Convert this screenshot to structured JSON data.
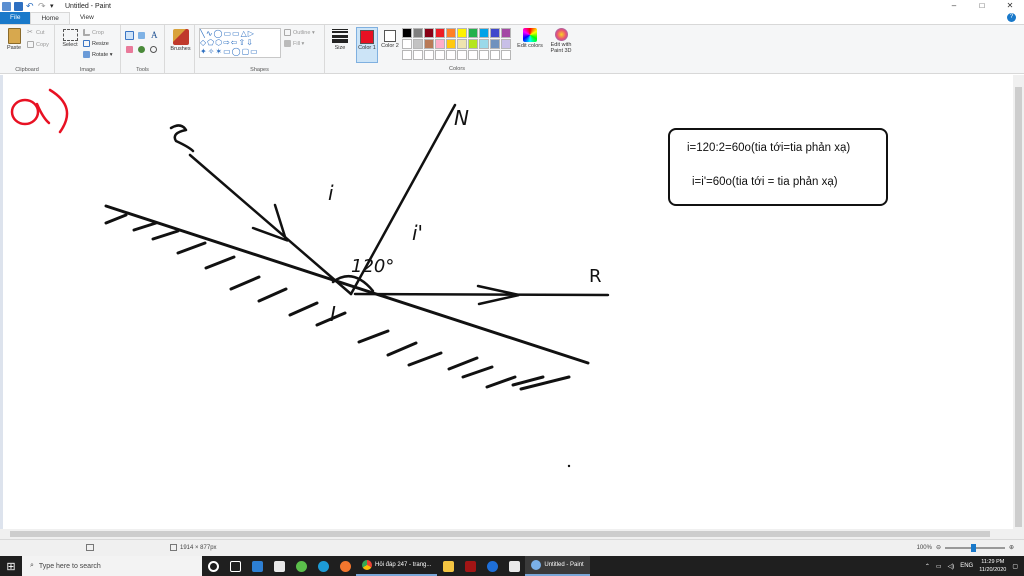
{
  "window": {
    "title": "Untitled - Paint",
    "controls": [
      "–",
      "□",
      "✕"
    ]
  },
  "tabs": [
    {
      "label": "File"
    },
    {
      "label": "Home"
    },
    {
      "label": "View"
    }
  ],
  "ribbon": {
    "clipboard": {
      "group_label": "Clipboard",
      "paste": "Paste",
      "cut": "Cut",
      "copy": "Copy"
    },
    "image": {
      "group_label": "Image",
      "select": "Select",
      "crop": "Crop",
      "resize": "Resize",
      "rotate": "Rotate ▾"
    },
    "tools": {
      "group_label": "Tools",
      "text_tool": "A"
    },
    "brushes": {
      "label": "Brushes"
    },
    "shapes": {
      "group_label": "Shapes",
      "outline": "Outline ▾",
      "fill": "Fill ▾"
    },
    "size": {
      "label": "Size"
    },
    "color1": {
      "label": "Color 1",
      "color": "#e81123"
    },
    "color2": {
      "label": "Color 2",
      "color": "#ffffff"
    },
    "colors": {
      "group_label": "Colors",
      "swatches": [
        "#000000",
        "#7f7f7f",
        "#880015",
        "#ed1c24",
        "#ff7f27",
        "#fff200",
        "#22b14c",
        "#00a2e8",
        "#3f48cc",
        "#a349a4",
        "#ffffff",
        "#c3c3c3",
        "#b97a57",
        "#ffaec9",
        "#ffc90e",
        "#efe4b0",
        "#b5e61d",
        "#99d9ea",
        "#7092be",
        "#c8bfe7",
        "#ffffff",
        "#ffffff",
        "#ffffff",
        "#ffffff",
        "#ffffff",
        "#ffffff",
        "#ffffff",
        "#ffffff",
        "#ffffff",
        "#ffffff"
      ]
    },
    "edit_colors": "Edit colors",
    "paint3d": "Edit with Paint 3D"
  },
  "drawing": {
    "label_a": "a)",
    "label_S": "S",
    "label_N": "N",
    "label_R": "R",
    "label_I": "I",
    "label_i": "i",
    "label_i_prime": "i'",
    "label_angle": "120°",
    "note_line1": "i=120:2=60o(tia tới=tia phản xạ)",
    "note_line2": "i=i'=60o(tia tới = tia phản xạ)"
  },
  "statusbar": {
    "dimensions": "1914 × 877px",
    "zoom": "100%"
  },
  "taskbar": {
    "search_placeholder": "Type here to search",
    "apps": [
      {
        "label": "Hỏi đáp 247 - trang...",
        "icon": "chrome-icon"
      },
      {
        "label": "Untitled - Paint",
        "icon": "paint-icon"
      }
    ],
    "lang": "ENG",
    "time": "11:29 PM",
    "date": "11/20/2020"
  }
}
